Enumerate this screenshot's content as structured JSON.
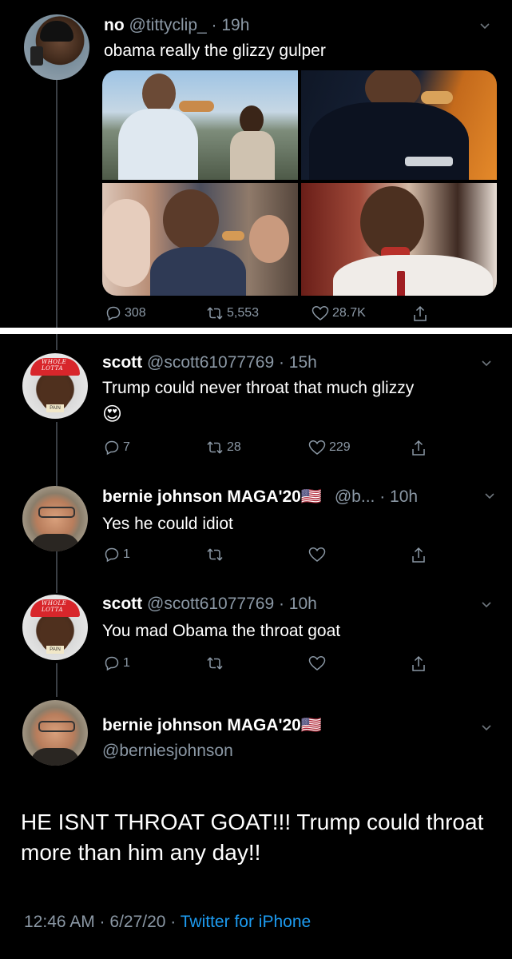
{
  "colors": {
    "background": "#000000",
    "text": "#ffffff",
    "muted": "#8b98a5",
    "link": "#1d9bf0",
    "divider": "#ffffff"
  },
  "tweets": [
    {
      "name": "no",
      "handle": "@tittyclip_",
      "time": "· 19h",
      "text": "obama really the glizzy gulper",
      "images": [
        "photo-1",
        "photo-2",
        "photo-3",
        "photo-4"
      ],
      "replies": "308",
      "retweets": "5,553",
      "likes": "28.7K",
      "avatar_icon": "profile-avatar"
    },
    {
      "name": "scott",
      "handle": "@scott61077769",
      "time": "· 15h",
      "text": "Trump could never throat that much glizzy",
      "emoji": "😍",
      "replies": "7",
      "retweets": "28",
      "likes": "229",
      "avatar_cap_text": "WHOLE LOTTA",
      "avatar_tag": "PAIN"
    },
    {
      "name": "bernie johnson MAGA'20",
      "flag": "🇺🇸",
      "handle": "@b...",
      "time": "· 10h",
      "text": "Yes he could idiot",
      "replies": "1"
    },
    {
      "name": "scott",
      "handle": "@scott61077769",
      "time": "· 10h",
      "text": "You mad Obama the throat goat",
      "replies": "1",
      "avatar_cap_text": "WHOLE LOTTA",
      "avatar_tag": "PAIN"
    }
  ],
  "focused_tweet": {
    "name": "bernie johnson MAGA'20",
    "flag": "🇺🇸",
    "handle": "@berniesjohnson",
    "text": "HE ISNT THROAT GOAT!!! Trump could throat more than him any day!!",
    "time": "12:46 AM · 6/27/20 ·",
    "source": "Twitter for iPhone"
  }
}
